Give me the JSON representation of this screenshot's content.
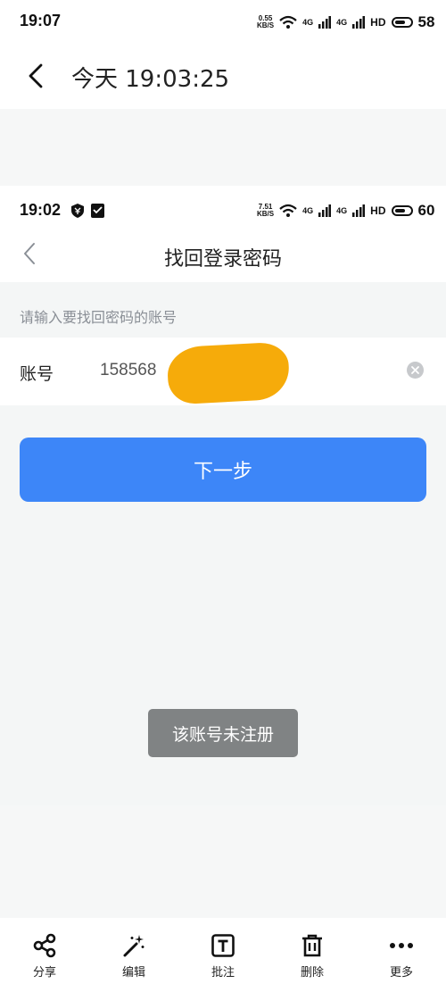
{
  "viewer": {
    "status": {
      "time": "19:07",
      "speed_value": "0.55",
      "speed_unit": "KB/S",
      "signal1": "4G",
      "signal2": "4G",
      "hd": "HD",
      "battery": "58"
    },
    "header": {
      "title": "今天 19:03:25"
    },
    "toolbar": {
      "items": [
        {
          "label": "分享",
          "icon": "share-icon"
        },
        {
          "label": "编辑",
          "icon": "magic-wand-icon"
        },
        {
          "label": "批注",
          "icon": "text-annotate-icon"
        },
        {
          "label": "删除",
          "icon": "trash-icon"
        },
        {
          "label": "更多",
          "icon": "more-dots-icon"
        }
      ]
    }
  },
  "screenshot": {
    "status": {
      "time": "19:02",
      "speed_value": "7.51",
      "speed_unit": "KB/S",
      "signal1": "4G",
      "signal2": "4G",
      "hd": "HD",
      "battery": "60"
    },
    "nav": {
      "title": "找回登录密码"
    },
    "hint": "请输入要找回密码的账号",
    "account": {
      "label": "账号",
      "value": "158568"
    },
    "next_button": "下一步",
    "toast": "该账号未注册"
  },
  "colors": {
    "primary_blue": "#3d86f8",
    "redaction": "#f6ab0a",
    "toast_bg": "#808384",
    "page_bg": "#f4f6f6"
  }
}
